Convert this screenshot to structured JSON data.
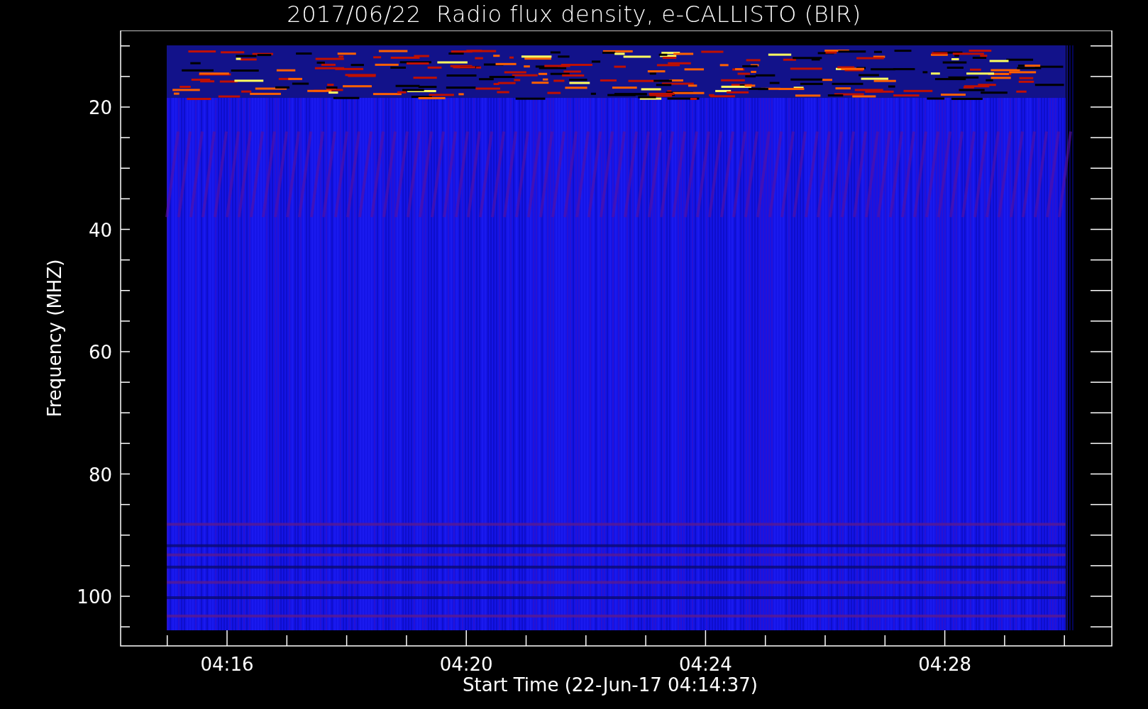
{
  "title": "2017/06/22  Radio flux density, e-CALLISTO (BIR)",
  "plot": {
    "ylabel": "Frequency (MHZ)",
    "xlabel": "Start Time (22-Jun-17 04:14:37)",
    "yticks": [
      {
        "label": "20"
      },
      {
        "label": "40"
      },
      {
        "label": "60"
      },
      {
        "label": "80"
      },
      {
        "label": "100"
      }
    ],
    "xticks": [
      {
        "label": "04:16"
      },
      {
        "label": "04:20"
      },
      {
        "label": "04:24"
      },
      {
        "label": "04:28"
      }
    ]
  }
}
